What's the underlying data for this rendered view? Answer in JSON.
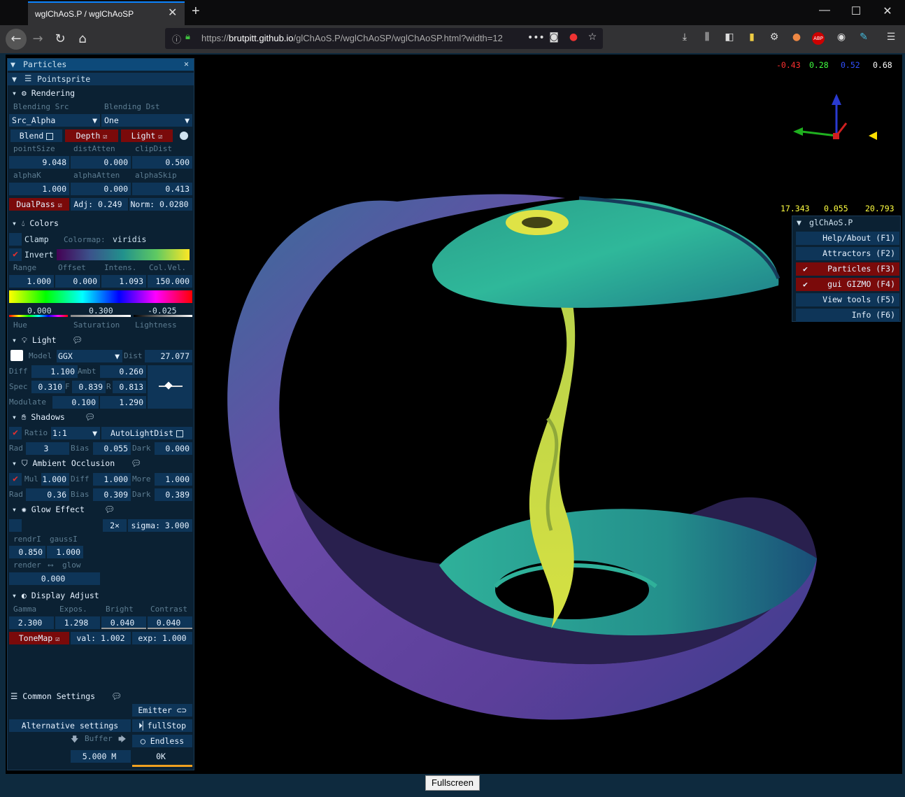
{
  "browser": {
    "tab_title": "wglChAoS.P / wglChAoSP",
    "url_prefix": "https://",
    "url_host": "brutpitt.github.io",
    "url_path": "/glChAoS.P/wglChAoSP/wglChAoSP.html?width=12",
    "fullscreen_label": "Fullscreen"
  },
  "viewport": {
    "coords_top": [
      "-0.43",
      "0.28",
      "0.52",
      "0.68"
    ],
    "coords_top_colors": [
      "#ff3030",
      "#40ff40",
      "#3050ff",
      "#ffffff"
    ],
    "coords_mid": [
      "17.343",
      "0.055",
      "20.793"
    ],
    "coords_mid_color": "#ffff40"
  },
  "particles": {
    "title": "Particles",
    "pointsprite": "Pointsprite",
    "rendering": {
      "title": "Rendering",
      "blend_src_label": "Blending Src",
      "blend_dst_label": "Blending Dst",
      "blend_src": "Src_Alpha",
      "blend_dst": "One",
      "blend": "Blend",
      "depth": "Depth",
      "light": "Light",
      "labels1": [
        "pointSize",
        "distAtten",
        "clipDist"
      ],
      "values1": [
        "9.048",
        "0.000",
        "0.500"
      ],
      "labels2": [
        "alphaK",
        "alphaAtten",
        "alphaSkip"
      ],
      "values2": [
        "1.000",
        "0.000",
        "0.413"
      ],
      "dualpass": "DualPass",
      "adj": "Adj: 0.249",
      "norm": "Norm: 0.0280"
    },
    "colors": {
      "title": "Colors",
      "clamp": "Clamp",
      "colormap_label": "Colormap:",
      "colormap": "viridis",
      "invert": "Invert",
      "labels": [
        "Range",
        "Offset",
        "Intens.",
        "Col.Vel."
      ],
      "values": [
        "1.000",
        "0.000",
        "1.093",
        "150.000"
      ],
      "hsl_values": [
        "0.000",
        "0.300",
        "-0.025"
      ],
      "hsl_labels": [
        "Hue",
        "Saturation",
        "Lightness"
      ]
    },
    "light": {
      "title": "Light",
      "model_label": "Model",
      "model": "GGX",
      "dist_label": "Dist",
      "dist": "27.077",
      "diff_label": "Diff",
      "diff": "1.100",
      "ambt_label": "Ambt",
      "ambt": "0.260",
      "spec_label": "Spec",
      "spec": "0.310",
      "f_label": "F",
      "f": "0.839",
      "r_label": "R",
      "r": "0.813",
      "modulate_label": "Modulate",
      "modulate": [
        "0.100",
        "1.290"
      ]
    },
    "shadows": {
      "title": "Shadows",
      "ratio_label": "Ratio",
      "ratio": "1:1",
      "autolight": "AutoLightDist",
      "rad_label": "Rad",
      "rad": "3",
      "bias_label": "Bias",
      "bias": "0.055",
      "dark_label": "Dark",
      "dark": "0.000"
    },
    "ao": {
      "title": "Ambient Occlusion",
      "mul_label": "Mul",
      "mul": "1.000",
      "diff_label": "Diff",
      "diff": "1.000",
      "more_label": "More",
      "more": "1.000",
      "rad_label": "Rad",
      "rad": "0.36",
      "bias_label": "Bias",
      "bias": "0.309",
      "dark_label": "Dark",
      "dark": "0.389"
    },
    "glow": {
      "title": "Glow Effect",
      "mult": "2×",
      "sigma": "sigma: 3.000",
      "labels": [
        "rendrI",
        "gaussI"
      ],
      "values": [
        "0.850",
        "1.000"
      ],
      "render_glow_left": "render",
      "render_glow_right": "glow",
      "mix": "0.000"
    },
    "display": {
      "title": "Display Adjust",
      "labels": [
        "Gamma",
        "Expos.",
        "Bright",
        "Contrast"
      ],
      "values": [
        "2.300",
        "1.298",
        "0.040",
        "0.040"
      ],
      "tonemap": "ToneMap",
      "val": "val: 1.002",
      "exp": "exp: 1.000"
    },
    "common": {
      "title": "Common Settings",
      "emitter": "Emitter",
      "alternative": "Alternative settings",
      "fullstop": "fullStop",
      "buffer": "Buffer",
      "endless": "Endless",
      "buffer_value": "5.000 M",
      "count": "0K"
    }
  },
  "gui": {
    "title": "glChAoS.P",
    "items": [
      {
        "label": "Help/About (F1)",
        "checked": false
      },
      {
        "label": "Attractors (F2)",
        "checked": false
      },
      {
        "label": "Particles  (F3)",
        "checked": true
      },
      {
        "label": "gui GIZMO  (F4)",
        "checked": true
      },
      {
        "label": "View tools (F5)",
        "checked": false
      },
      {
        "label": "Info       (F6)",
        "checked": false
      }
    ]
  }
}
